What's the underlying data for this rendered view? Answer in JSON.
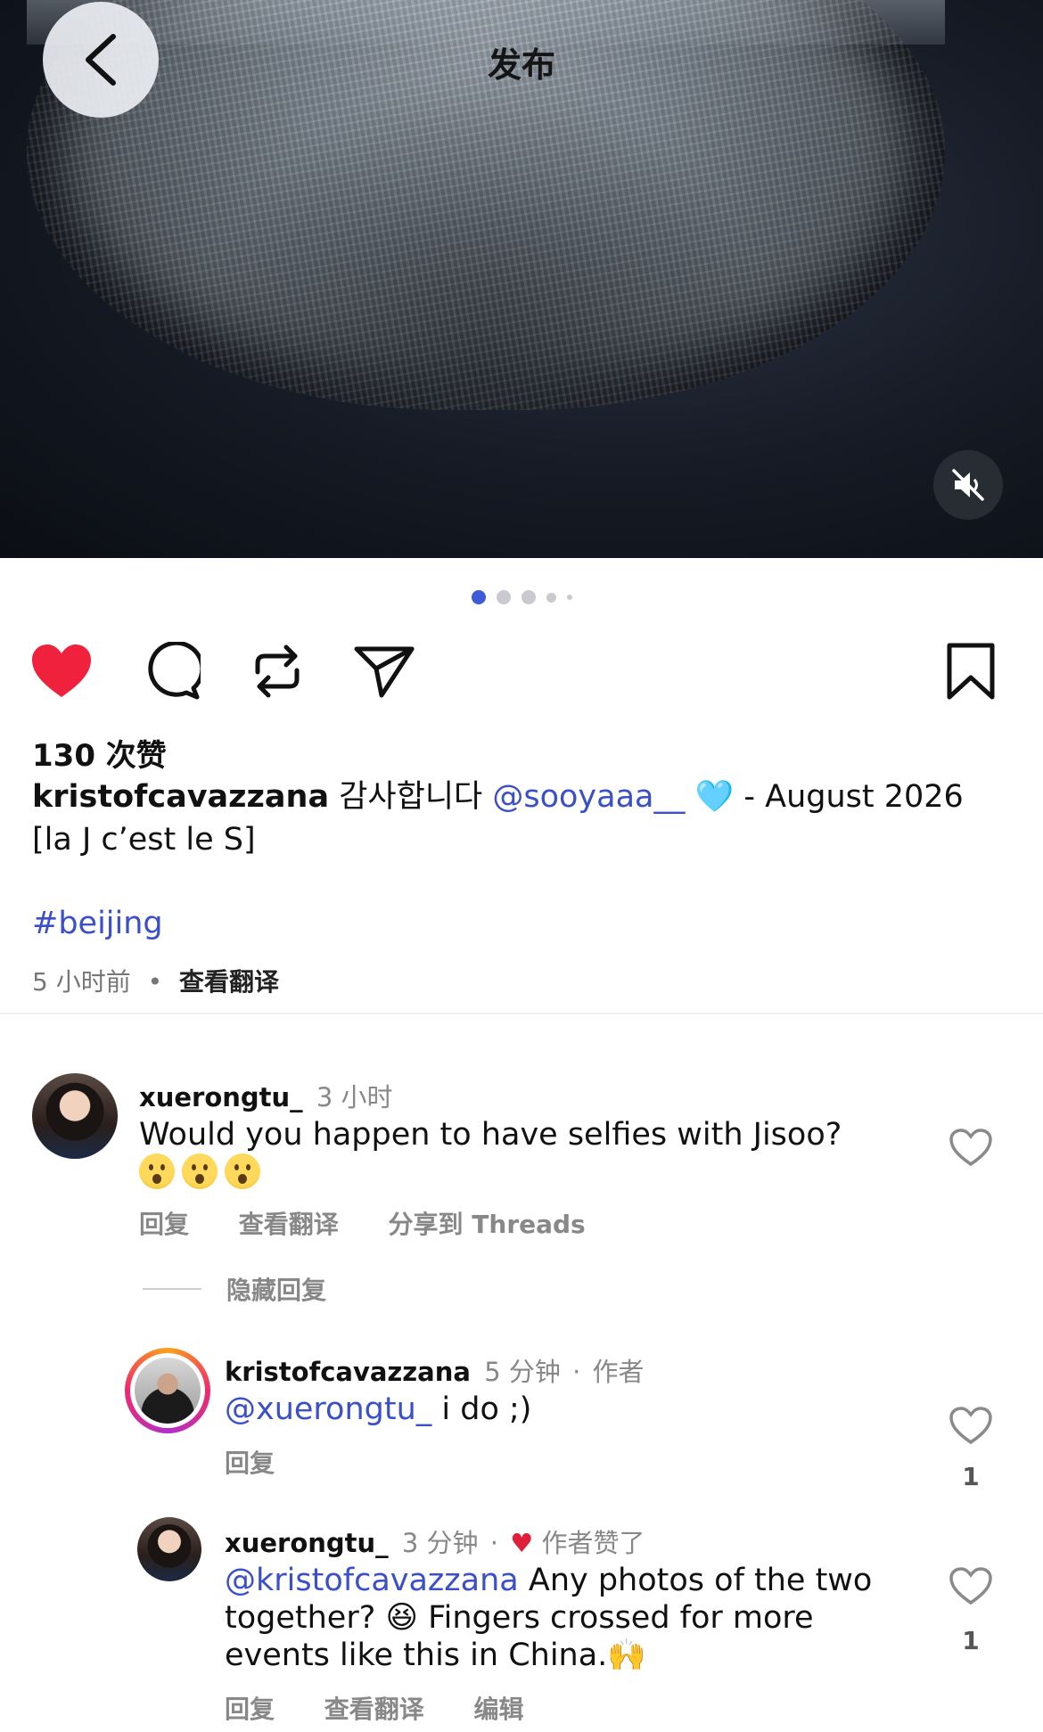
{
  "header": {
    "title": "发布",
    "back_icon": "chevron-left-icon",
    "mute_icon": "speaker-muted-icon"
  },
  "pagination": {
    "count": 5,
    "active_index": 0
  },
  "actions": {
    "like_icon": "heart-filled-icon",
    "comment_icon": "comment-icon",
    "repost_icon": "repost-icon",
    "share_icon": "send-icon",
    "save_icon": "bookmark-icon",
    "like_color": "#f0213d"
  },
  "post": {
    "likes": "130 次赞",
    "username": "kristofcavazzana",
    "caption_text": "감사합니다",
    "mention": "@sooyaaa__",
    "emoji": "🩵",
    "caption_tail": "- August 2026",
    "caption_line2": "[la J c’est le S]",
    "hashtag": "#beijing",
    "time": "5 小时前",
    "separator": "•",
    "see_translation": "查看翻译"
  },
  "comments": [
    {
      "username": "xuerongtu_",
      "time": "3 小时",
      "text": "Would you happen to have selfies with Jisoo?",
      "actions": [
        "回复",
        "查看翻译",
        "分享到 Threads"
      ],
      "hide_replies": "隐藏回复",
      "replies": [
        {
          "username": "kristofcavazzana",
          "time": "5 分钟",
          "dot": "·",
          "badge": "作者",
          "mention": "@xuerongtu_",
          "text": " i do ;)",
          "actions": [
            "回复"
          ],
          "likes": "1"
        },
        {
          "username": "xuerongtu_",
          "time": "3 分钟",
          "dot": "·",
          "liked_by_author": "作者赞了",
          "mention": "@kristofcavazzana",
          "text_part1": " Any photos of the two together?",
          "emoji_laugh": "😆",
          "text_part2": " Fingers crossed for more events like this in China.",
          "emoji_hands": "🙌",
          "actions": [
            "回复",
            "查看翻译",
            "编辑"
          ],
          "likes": "1"
        }
      ]
    }
  ]
}
